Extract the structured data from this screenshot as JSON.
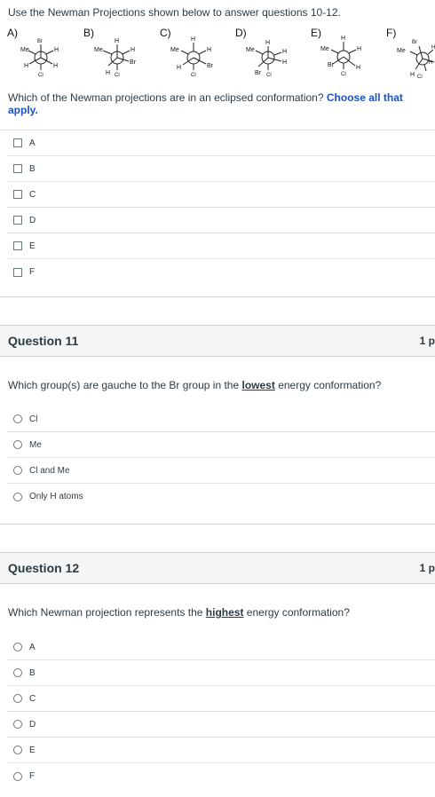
{
  "q10": {
    "intro": "Use the Newman Projections shown below to answer questions 10-12.",
    "figure_labels": [
      "A)",
      "B)",
      "C)",
      "D)",
      "E)",
      "F)"
    ],
    "prompt_main": "Which of the Newman projections are in an eclipsed conformation?",
    "prompt_hint": "Choose all that apply.",
    "options": [
      "A",
      "B",
      "C",
      "D",
      "E",
      "F"
    ]
  },
  "q11": {
    "title": "Question 11",
    "points": "1 p",
    "prompt_pre": "Which group(s) are gauche to the Br group in the",
    "prompt_em": "lowest",
    "prompt_post": "energy conformation?",
    "options": [
      "Cl",
      "Me",
      "Cl and Me",
      "Only H atoms"
    ]
  },
  "q12": {
    "title": "Question 12",
    "points": "1 p",
    "prompt_pre": "Which Newman projection represents the",
    "prompt_em": "highest",
    "prompt_post": "energy conformation?",
    "options": [
      "A",
      "B",
      "C",
      "D",
      "E",
      "F"
    ]
  },
  "newman": {
    "A": {
      "front": [
        "Br",
        "H",
        "H"
      ],
      "back": [
        "Me",
        "H",
        "Cl"
      ]
    },
    "B": {
      "front": [
        "H",
        "Br",
        "Cl"
      ],
      "back": [
        "Me",
        "H",
        "H"
      ]
    },
    "C": {
      "front": [
        "H",
        "Br",
        "Cl"
      ],
      "back": [
        "Me",
        "H",
        "H"
      ]
    },
    "D": {
      "front": [
        "H",
        "H",
        "Br"
      ],
      "back": [
        "Me",
        "H",
        "Cl"
      ]
    },
    "E": {
      "front": [
        "H",
        "H",
        "Cl"
      ],
      "back": [
        "Me",
        "H",
        "Br"
      ]
    },
    "F": {
      "front": [
        "Br",
        "H",
        "H"
      ],
      "back": [
        "Me",
        "H",
        "Cl"
      ]
    }
  }
}
